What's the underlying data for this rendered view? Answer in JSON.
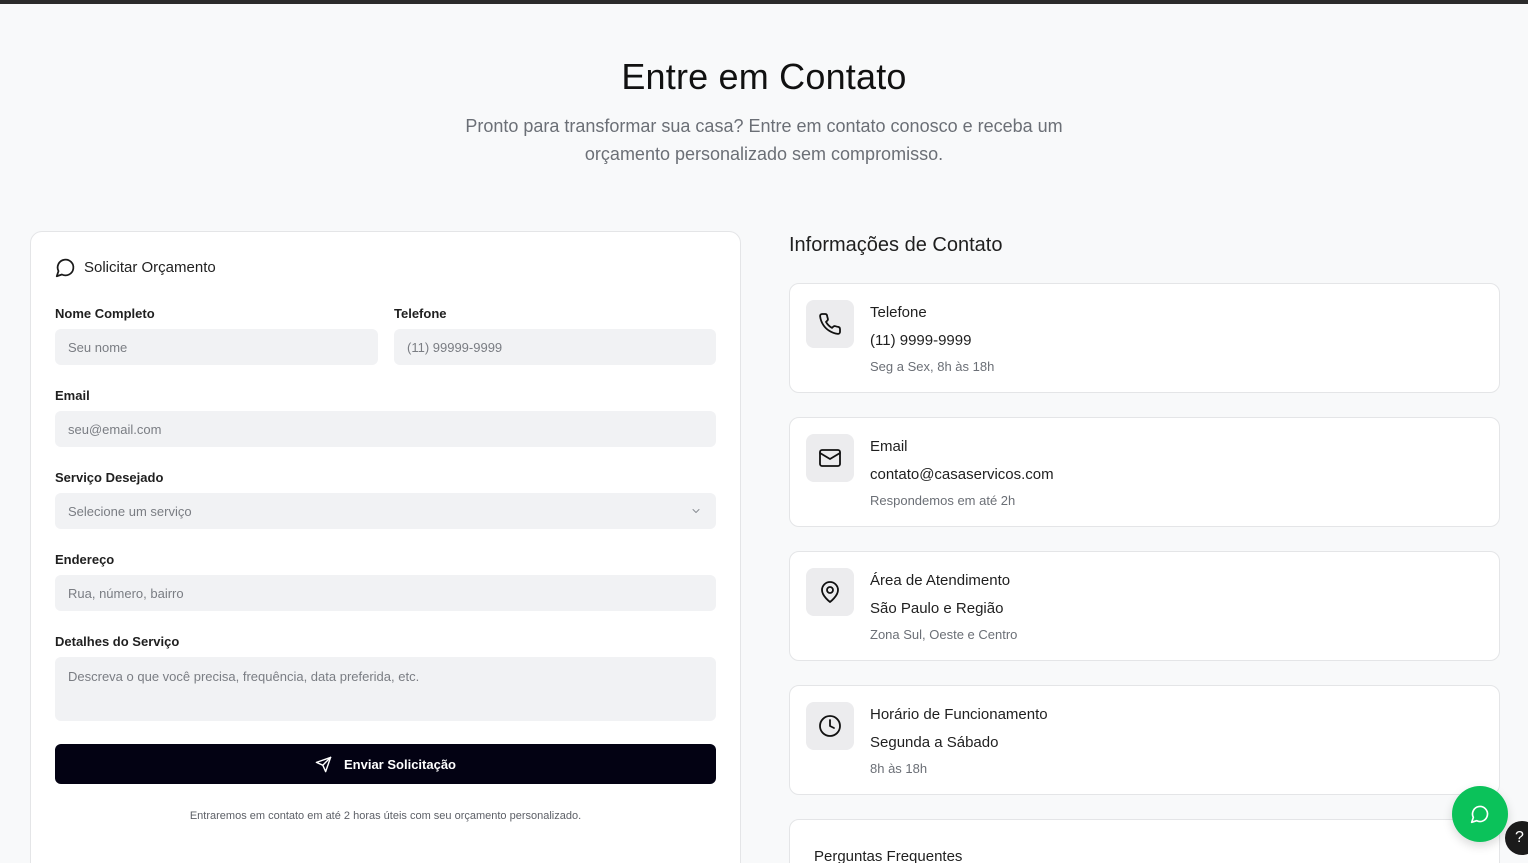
{
  "hero": {
    "title": "Entre em Contato",
    "subtitle": "Pronto para transformar sua casa? Entre em contato conosco e receba um orçamento personalizado sem compromisso."
  },
  "form": {
    "title": "Solicitar Orçamento",
    "title_icon": "message-circle-icon",
    "name_label": "Nome Completo",
    "name_placeholder": "Seu nome",
    "phone_label": "Telefone",
    "phone_placeholder": "(11) 99999-9999",
    "email_label": "Email",
    "email_placeholder": "seu@email.com",
    "service_label": "Serviço Desejado",
    "service_value": "Selecione um serviço",
    "address_label": "Endereço",
    "address_placeholder": "Rua, número, bairro",
    "details_label": "Detalhes do Serviço",
    "details_placeholder": "Descreva o que você precisa, frequência, data preferida, etc.",
    "submit_label": "Enviar Solicitação",
    "submit_icon": "send-icon",
    "note": "Entraremos em contato em até 2 horas úteis com seu orçamento personalizado."
  },
  "info": {
    "title": "Informações de Contato",
    "cards": [
      {
        "icon": "phone-icon",
        "title": "Telefone",
        "value": "(11) 9999-9999",
        "detail": "Seg a Sex, 8h às 18h"
      },
      {
        "icon": "mail-icon",
        "title": "Email",
        "value": "contato@casaservicos.com",
        "detail": "Respondemos em até 2h"
      },
      {
        "icon": "map-pin-icon",
        "title": "Área de Atendimento",
        "value": "São Paulo e Região",
        "detail": "Zona Sul, Oeste e Centro"
      },
      {
        "icon": "clock-icon",
        "title": "Horário de Funcionamento",
        "value": "Segunda a Sábado",
        "detail": "8h às 18h"
      }
    ],
    "faq_title": "Perguntas Frequentes"
  },
  "widgets": {
    "chat_icon": "chat-bubble-icon",
    "help_label": "?"
  },
  "colors": {
    "primary_button": "#030213",
    "chat_green": "#0bc25a",
    "input_bg": "#f1f2f4",
    "muted_text": "#6b6f76"
  }
}
